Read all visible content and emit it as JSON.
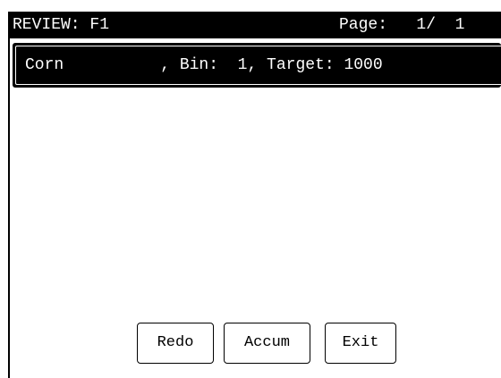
{
  "titlebar": {
    "left": "REVIEW: F1",
    "right": "Page:   1/  1"
  },
  "header": {
    "text": "Corn          , Bin:  1, Target: 1000"
  },
  "buttons": {
    "redo": "Redo",
    "accum": "Accum",
    "exit": "Exit"
  }
}
